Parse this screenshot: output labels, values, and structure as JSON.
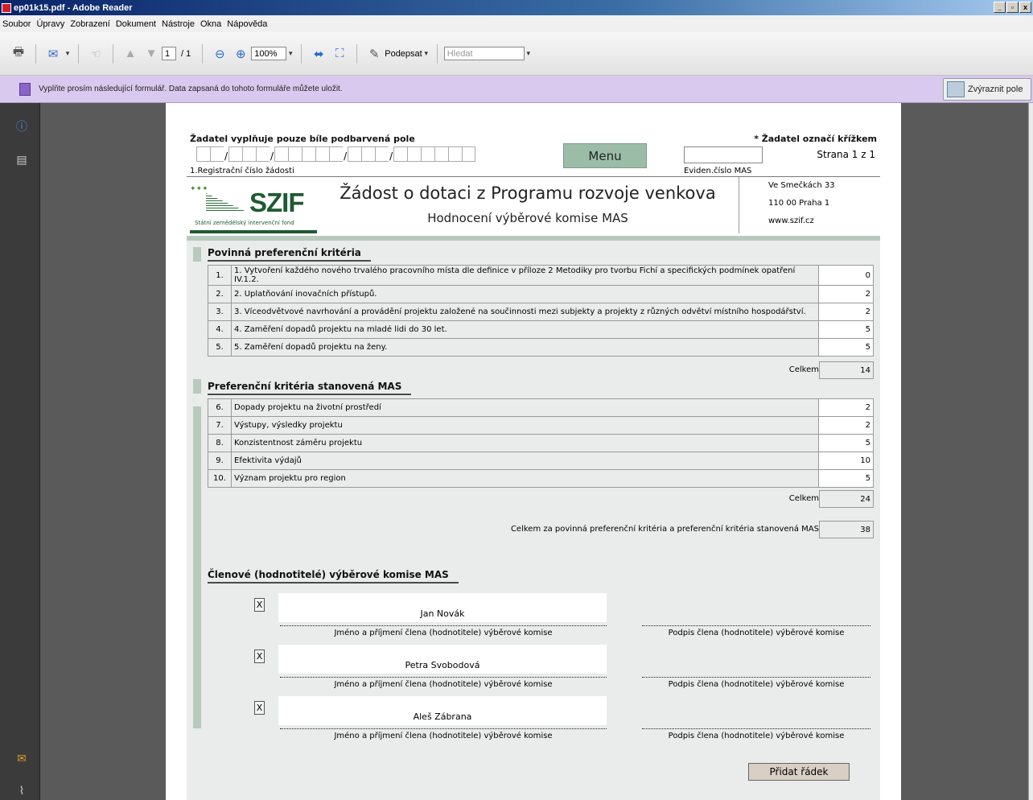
{
  "window": {
    "title": "ep01k15.pdf - Adobe Reader",
    "btn_min": "_",
    "btn_max": "▫",
    "btn_close": "x"
  },
  "menu": [
    "Soubor",
    "Úpravy",
    "Zobrazení",
    "Dokument",
    "Nástroje",
    "Okna",
    "Nápověda"
  ],
  "toolbar": {
    "page_current": "1",
    "page_total": "/ 1",
    "zoom": "100%",
    "sign_label": "Podepsat",
    "search_placeholder": "Hledat"
  },
  "formbar": {
    "message": "Vyplňte prosím následující formulář. Data zapsaná do tohoto formuláře můžete uložit.",
    "highlight_label": "Zvýraznit pole"
  },
  "form": {
    "header_left": "Žadatel vyplňuje pouze bíle podbarvená pole",
    "header_right": "* Žadatel označí křížkem",
    "reg_label": "1.Registrační číslo žádosti",
    "menu_button": "Menu",
    "evid_label": "Eviden.číslo MAS",
    "page_info": "Strana 1 z 1",
    "logo_text": "SZIF",
    "logo_sub": "Státní zemědělský intervenční fond",
    "title": "Žádost o dotaci z Programu rozvoje venkova",
    "subtitle": "Hodnocení výběrové komise MAS",
    "address": [
      "Ve Smečkách 33",
      "110 00 Praha 1",
      "www.szif.cz"
    ],
    "section1": {
      "title": "Povinná preferenční kritéria",
      "rows": [
        {
          "num": "1.",
          "text": "1. Vytvoření každého nového trvalého pracovního místa dle definice v příloze 2 Metodiky pro tvorbu Fichí a specifických podmínek opatření IV.1.2.",
          "value": "0"
        },
        {
          "num": "2.",
          "text": "2. Uplatňování inovačních přístupů.",
          "value": "2"
        },
        {
          "num": "3.",
          "text": "3. Víceodvětvové navrhování a provádění projektu založené na součinnosti mezi subjekty a projekty z různých odvětví místního hospodářství.",
          "value": "2"
        },
        {
          "num": "4.",
          "text": "4. Zaměření dopadů projektu na mladé lidi do 30 let.",
          "value": "5"
        },
        {
          "num": "5.",
          "text": "5. Zaměření dopadů projektu na ženy.",
          "value": "5"
        }
      ],
      "total_label": "Celkem",
      "total": "14"
    },
    "section2": {
      "title": "Preferenční kritéria stanovená MAS",
      "rows": [
        {
          "num": "6.",
          "text": "Dopady projektu na životní prostředí",
          "value": "2"
        },
        {
          "num": "7.",
          "text": "Výstupy, výsledky projektu",
          "value": "2"
        },
        {
          "num": "8.",
          "text": "Konzistentnost záměru projektu",
          "value": "5"
        },
        {
          "num": "9.",
          "text": "Efektivita výdajů",
          "value": "10"
        },
        {
          "num": "10.",
          "text": "Význam projektu pro region",
          "value": "5"
        }
      ],
      "total_label": "Celkem",
      "total": "24"
    },
    "grand_total_label": "Celkem za povinná preferenční kritéria a preferenční kritéria stanovená MAS",
    "grand_total": "38",
    "section3": {
      "title": "Členové (hodnotitelé) výběrové komise MAS",
      "members": [
        {
          "check": "X",
          "name": "Jan Novák"
        },
        {
          "check": "X",
          "name": "Petra Svobodová"
        },
        {
          "check": "X",
          "name": "Aleš Zábrana"
        }
      ],
      "name_caption": "Jméno a příjmení člena (hodnotitele) výběrové komise",
      "sign_caption": "Podpis člena (hodnotitele) výběrové komise",
      "add_row": "Přidat řádek"
    }
  }
}
